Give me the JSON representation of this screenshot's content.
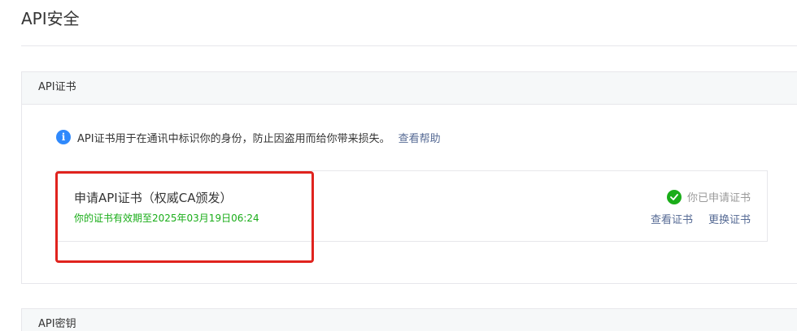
{
  "page": {
    "title": "API安全"
  },
  "cert_section": {
    "header": "API证书",
    "tip": {
      "icon": "info-icon",
      "text": "API证书用于在通讯中标识你的身份，防止因盗用而给你带来损失。",
      "help_link": "查看帮助"
    },
    "card": {
      "name": "申请API证书（权威CA颁发）",
      "validity": "你的证书有效期至2025年03月19日06:24",
      "status_icon": "check-circle-icon",
      "status": "你已申请证书",
      "view_link": "查看证书",
      "replace_link": "更换证书"
    }
  },
  "key_section": {
    "header": "API密钥"
  },
  "colors": {
    "link": "#576b95",
    "success": "#1aad19",
    "info": "#2f89fc",
    "highlight": "#e0231e"
  }
}
